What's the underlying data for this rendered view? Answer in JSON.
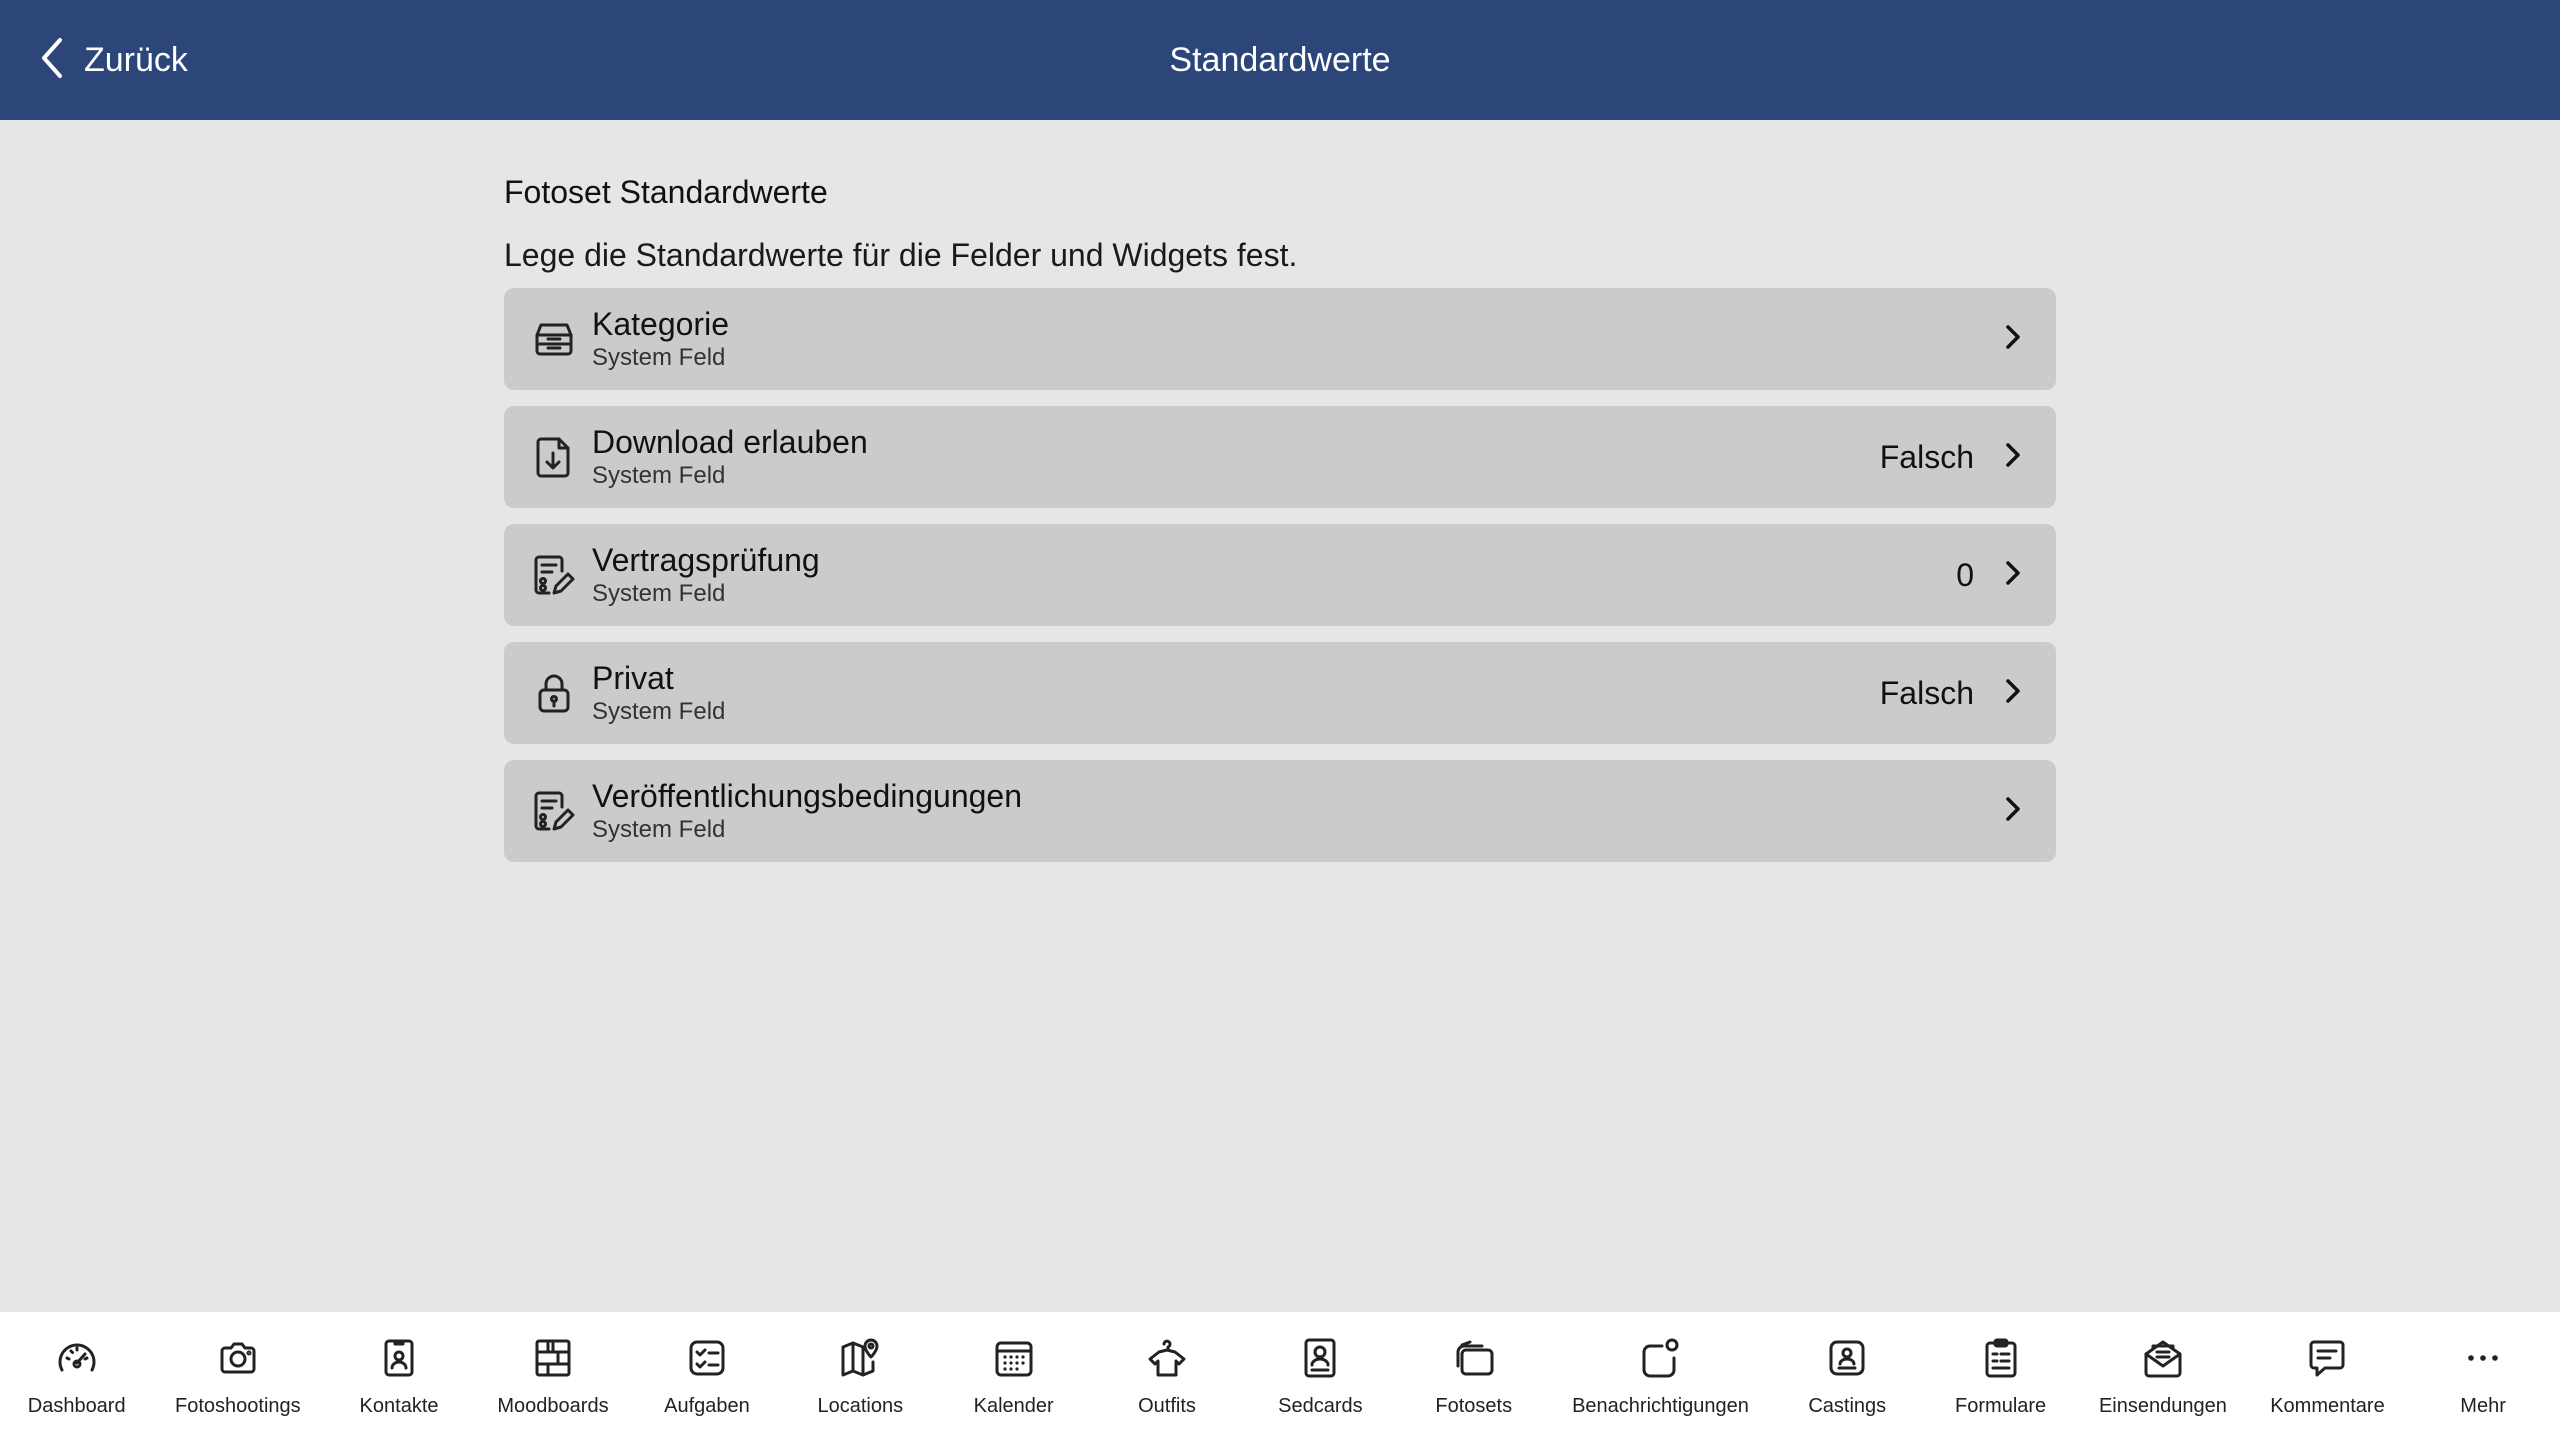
{
  "header": {
    "back_label": "Zurück",
    "title": "Standardwerte",
    "background_color": "#2c4679"
  },
  "main": {
    "section_title": "Fotoset Standardwerte",
    "section_description": "Lege die Standardwerte für die Felder und Widgets fest.",
    "rows": [
      {
        "icon": "inbox-stack-icon",
        "title": "Kategorie",
        "subtitle": "System Feld",
        "value": ""
      },
      {
        "icon": "file-download-icon",
        "title": "Download erlauben",
        "subtitle": "System Feld",
        "value": "Falsch"
      },
      {
        "icon": "document-edit-icon",
        "title": "Vertragsprüfung",
        "subtitle": "System Feld",
        "value": "0"
      },
      {
        "icon": "lock-icon",
        "title": "Privat",
        "subtitle": "System Feld",
        "value": "Falsch"
      },
      {
        "icon": "document-edit-icon",
        "title": "Veröffentlichungsbedingungen",
        "subtitle": "System Feld",
        "value": ""
      }
    ]
  },
  "tabbar": {
    "items": [
      {
        "icon": "speedometer-icon",
        "label": "Dashboard"
      },
      {
        "icon": "camera-icon",
        "label": "Fotoshootings"
      },
      {
        "icon": "contact-card-icon",
        "label": "Kontakte"
      },
      {
        "icon": "moodboard-grid-icon",
        "label": "Moodboards"
      },
      {
        "icon": "checklist-icon",
        "label": "Aufgaben"
      },
      {
        "icon": "map-pin-icon",
        "label": "Locations"
      },
      {
        "icon": "calendar-icon",
        "label": "Kalender"
      },
      {
        "icon": "shirt-hanger-icon",
        "label": "Outfits"
      },
      {
        "icon": "sedcard-icon",
        "label": "Sedcards"
      },
      {
        "icon": "photo-stack-icon",
        "label": "Fotosets"
      },
      {
        "icon": "notification-icon",
        "label": "Benachrichtigungen"
      },
      {
        "icon": "casting-badge-icon",
        "label": "Castings"
      },
      {
        "icon": "clipboard-form-icon",
        "label": "Formulare"
      },
      {
        "icon": "mail-open-icon",
        "label": "Einsendungen"
      },
      {
        "icon": "comment-icon",
        "label": "Kommentare"
      },
      {
        "icon": "more-dots-icon",
        "label": "Mehr"
      }
    ]
  }
}
